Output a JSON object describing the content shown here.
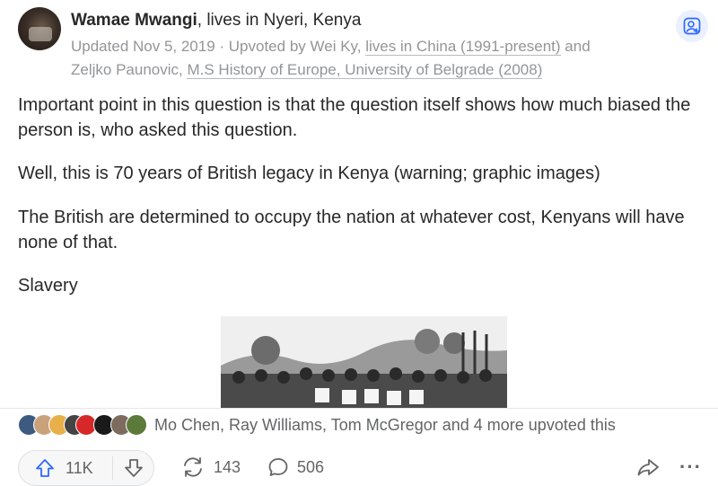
{
  "author": {
    "name": "Wamae Mwangi",
    "credential": ", lives in Nyeri, Kenya",
    "meta_updated": "Updated Nov 5, 2019 · Upvoted by ",
    "upvoter1_name": "Wei Ky",
    "upvoter1_sep": ", ",
    "upvoter1_cred": "lives in China (1991-present)",
    "and": " and",
    "upvoter2_name": "Zeljko Paunovic",
    "upvoter2_sep": ", ",
    "upvoter2_cred": "M.S History of Europe, University of Belgrade (2008)"
  },
  "content": {
    "paragraphs": [
      "Important point in this question is that the question itself shows how much biased the person is, who asked this question.",
      "Well, this is 70 years of British legacy in Kenya (warning; graphic images)",
      "The British are determined to occupy the nation at whatever cost, Kenyans will have none of that.",
      "Slavery"
    ]
  },
  "upvoters": {
    "summary": "Mo Chen, Ray Williams, Tom McGregor and 4 more upvoted this"
  },
  "actions": {
    "upvote_count": "11K",
    "share_count": "143",
    "comment_count": "506",
    "more_label": "···"
  },
  "icons": {
    "follow": "add-person-icon",
    "upvote": "arrow-up-icon",
    "downvote": "arrow-down-icon",
    "share": "reshare-icon",
    "comment": "comment-bubble-icon",
    "forward": "forward-arrow-icon",
    "more": "ellipsis-icon"
  },
  "colors": {
    "accent": "#2e69ff",
    "text": "#282829",
    "muted": "#939598",
    "icon": "#636466"
  }
}
